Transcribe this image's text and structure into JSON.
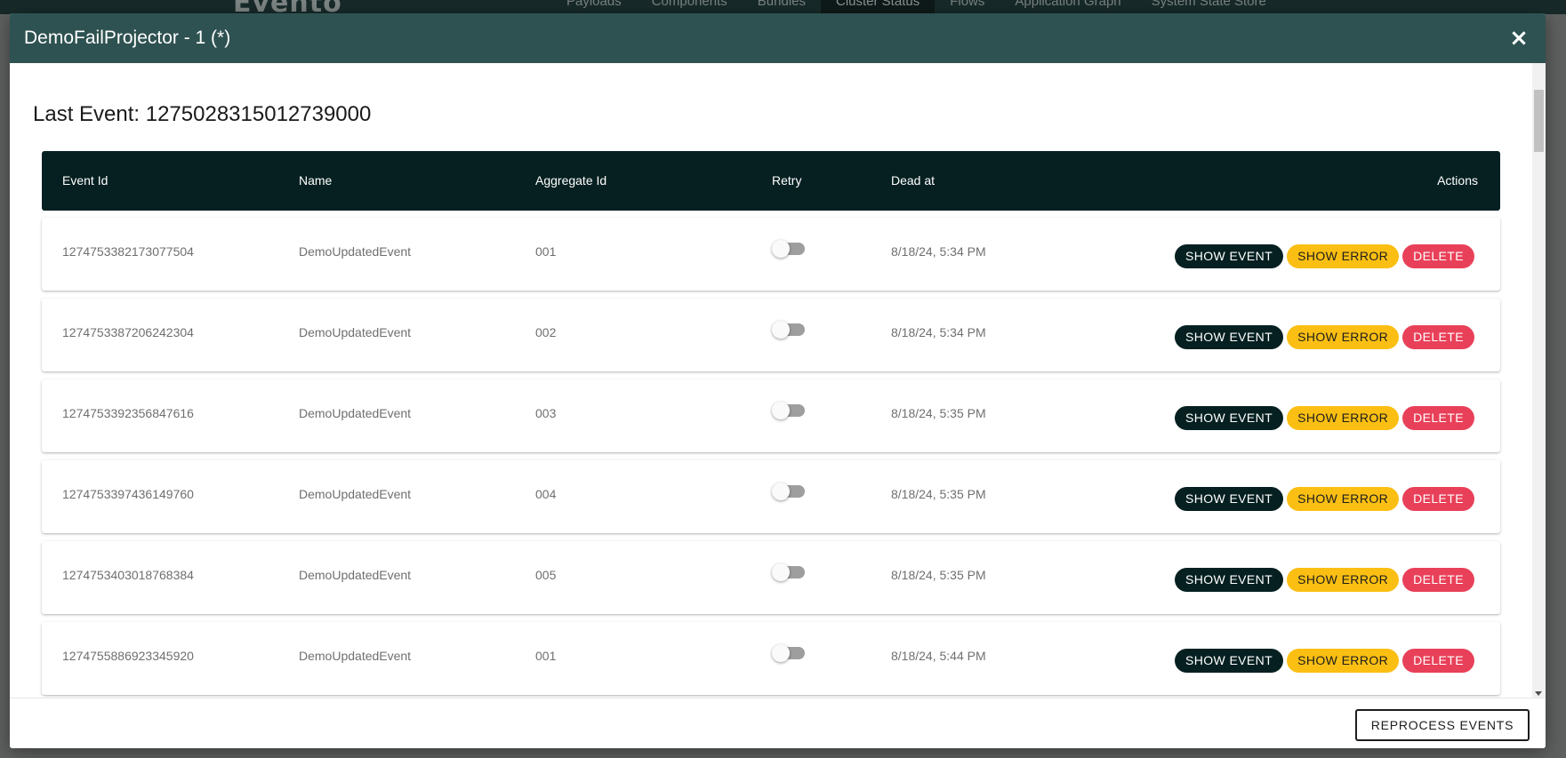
{
  "background_nav": {
    "logo": "Evento",
    "menu": [
      "Payloads",
      "Components",
      "Bundles",
      "Cluster Status",
      "Flows",
      "Application Graph",
      "System State Store"
    ],
    "active": "Cluster Status"
  },
  "modal": {
    "title": "DemoFailProjector - 1 (*)",
    "close_label": "×",
    "last_event": "Last Event: 1275028315012739000",
    "table": {
      "headers": {
        "event_id": "Event Id",
        "name": "Name",
        "aggregate_id": "Aggregate Id",
        "retry": "Retry",
        "dead_at": "Dead at",
        "actions": "Actions"
      },
      "rows": [
        {
          "event_id": "1274753382173077504",
          "name": "DemoUpdatedEvent",
          "aggregate_id": "001",
          "retry": false,
          "dead_at": "8/18/24, 5:34 PM"
        },
        {
          "event_id": "1274753387206242304",
          "name": "DemoUpdatedEvent",
          "aggregate_id": "002",
          "retry": false,
          "dead_at": "8/18/24, 5:34 PM"
        },
        {
          "event_id": "1274753392356847616",
          "name": "DemoUpdatedEvent",
          "aggregate_id": "003",
          "retry": false,
          "dead_at": "8/18/24, 5:35 PM"
        },
        {
          "event_id": "1274753397436149760",
          "name": "DemoUpdatedEvent",
          "aggregate_id": "004",
          "retry": false,
          "dead_at": "8/18/24, 5:35 PM"
        },
        {
          "event_id": "1274753403018768384",
          "name": "DemoUpdatedEvent",
          "aggregate_id": "005",
          "retry": false,
          "dead_at": "8/18/24, 5:35 PM"
        },
        {
          "event_id": "1274755886923345920",
          "name": "DemoUpdatedEvent",
          "aggregate_id": "001",
          "retry": false,
          "dead_at": "8/18/24, 5:44 PM"
        }
      ],
      "action_labels": {
        "show_event": "SHOW EVENT",
        "show_error": "SHOW ERROR",
        "delete": "DELETE"
      }
    },
    "footer": {
      "reprocess_label": "REPROCESS EVENTS"
    }
  },
  "colors": {
    "header_bg": "#2e5251",
    "table_header_bg": "#062021",
    "show_event": "#062021",
    "show_error": "#fbbf13",
    "delete": "#e94059"
  }
}
